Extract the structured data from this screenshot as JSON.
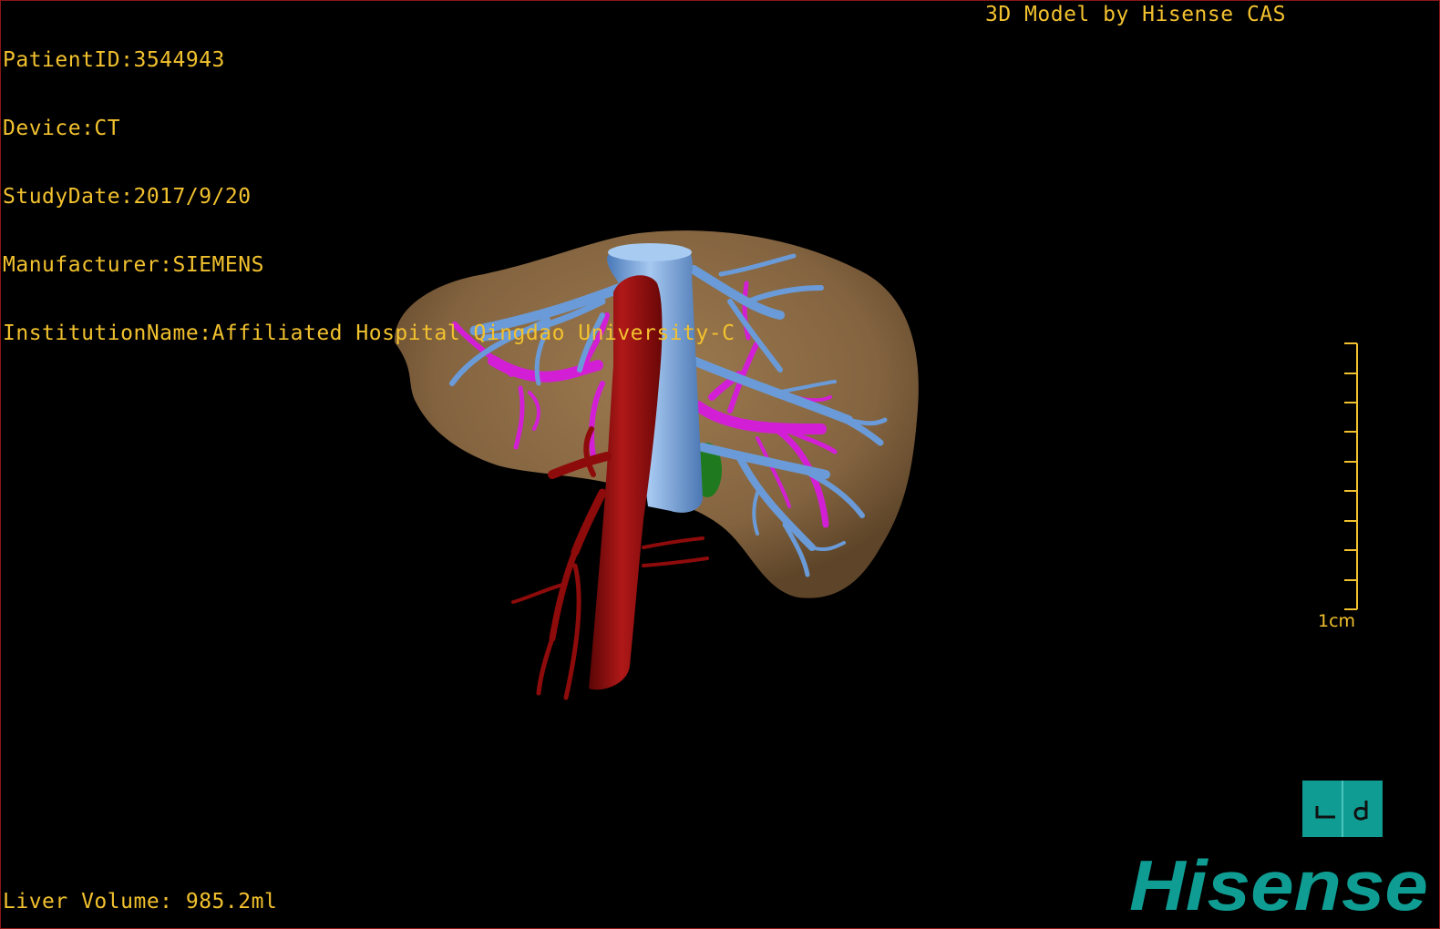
{
  "viewer": {
    "patient_id": "PatientID:3544943",
    "device": "Device:CT",
    "study_date": "StudyDate:2017/9/20",
    "manufacturer": "Manufacturer:SIEMENS",
    "institution": "InstitutionName:Affiliated Hospital Qingdao University-C",
    "credit": "3D Model by Hisense CAS",
    "liver_volume": "Liver Volume: 985.2ml",
    "scale_label": "1cm",
    "brand": "Hisense",
    "view_button_glyph": "┗ d",
    "model_parts": [
      "liver",
      "hepatic-veins",
      "portal-vein",
      "aorta",
      "arteries",
      "gallbladder"
    ]
  },
  "colors": {
    "overlay_text": "#f2c12e",
    "liver": "#8b6b45",
    "hepatic_vein": "#6a9bd8",
    "portal_vein": "#d21fd6",
    "aorta": "#8e0b0b",
    "gallbladder": "#1f7a1f",
    "brand": "#0f9d93",
    "frame": "#8a1616"
  }
}
